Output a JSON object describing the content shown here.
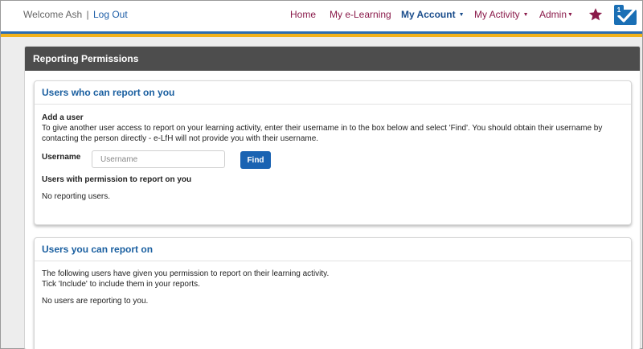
{
  "header": {
    "welcome": "Welcome Ash",
    "separator": "|",
    "logout": "Log Out",
    "notification_count": "1"
  },
  "nav": {
    "items": [
      {
        "label": "Home"
      },
      {
        "label": "My e-Learning"
      },
      {
        "label": "My Account"
      },
      {
        "label": "My Activity"
      },
      {
        "label": "Admin"
      }
    ]
  },
  "icons": {
    "favourites": "star-icon",
    "messages": "mail-check-icon"
  },
  "colors": {
    "nav_link": "#8a1a4a",
    "nav_active": "#1a4d8c",
    "stripe_blue": "#2a6db3",
    "stripe_gold": "#f2b21b",
    "panel_header": "#4d4d4d",
    "button": "#1a63b2"
  },
  "panel": {
    "title": "Reporting Permissions"
  },
  "reporters_card": {
    "title": "Users who can report on you",
    "add_heading": "Add a user",
    "add_description": "To give another user access to report on your learning activity, enter their username in to the box below and select 'Find'. You should obtain their username by contacting the person directly - e-LfH will not provide you with their username.",
    "username_label": "Username",
    "username_placeholder": "Username",
    "username_value": "",
    "find_label": "Find",
    "list_heading": "Users with permission to report on you",
    "empty_text": "No reporting users."
  },
  "reportees_card": {
    "title": "Users you can report on",
    "line1": "The following users have given you permission to report on their learning activity.",
    "line2": "Tick 'Include' to include them in your reports.",
    "empty_text": "No users are reporting to you."
  }
}
